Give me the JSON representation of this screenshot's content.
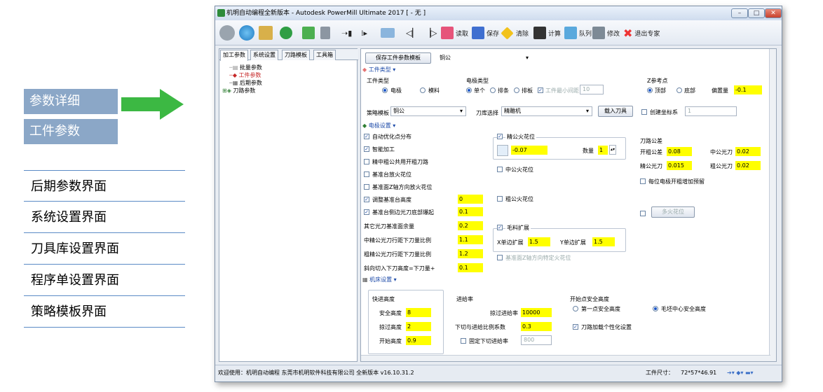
{
  "annotations": {
    "tags": [
      "参数详细",
      "工件参数"
    ],
    "list": [
      "后期参数界面",
      "系统设置界面",
      "刀具库设置界面",
      "程序单设置界面",
      "策略模板界面"
    ]
  },
  "window": {
    "title": "机明自动编程全新版本 - Autodesk PowerMill Ultimate 2017  [ - 无 ]",
    "controls": [
      "minimize",
      "maximize",
      "close"
    ]
  },
  "toolbar": {
    "icons": [
      "gear-icon",
      "globe-icon",
      "clipboard-icon",
      "plus-circle-icon",
      "grid-icon",
      "wrench-icon",
      "step-in-icon",
      "step-icon",
      "folder-icon",
      "first-icon",
      "last-icon"
    ],
    "labeled": [
      {
        "icon": "read-icon",
        "label": "读取"
      },
      {
        "icon": "save-icon",
        "label": "保存"
      },
      {
        "icon": "clear-icon",
        "label": "清除"
      },
      {
        "icon": "calc-icon",
        "label": "计算"
      },
      {
        "icon": "queue-icon",
        "label": "队列"
      },
      {
        "icon": "modify-icon",
        "label": "修改"
      },
      {
        "icon": "exit-icon",
        "label": "退出专家"
      }
    ]
  },
  "left_panel": {
    "tabs": [
      "加工参数",
      "系统设置",
      "刀路模板",
      "工具箱"
    ],
    "tree": [
      "批量参数",
      "工件参数",
      "后期参数",
      "刀路参数"
    ]
  },
  "right_panel": {
    "save_template_button": "保存工件参数模板",
    "template_value": "铜公",
    "workpiece_section": "工件类型",
    "workpiece_type_label": "工件类型",
    "workpiece_type_options": [
      "电极",
      "模料"
    ],
    "electrode_type_label": "电极类型",
    "electrode_type_options": [
      "单个",
      "排条",
      "排板"
    ],
    "min_spacing_label": "工件最小间距",
    "min_spacing_value": "10",
    "z_ref_label": "Z参考点",
    "z_ref_options": [
      "顶部",
      "底部"
    ],
    "offset_label": "偏置量",
    "offset_value": "-0.1",
    "strategy_template_label": "策略模板",
    "strategy_template_value": "铜公",
    "tool_library_label": "刀库选择",
    "tool_library_value": "精雕机",
    "load_tool_button": "载入刀具",
    "create_coord_label": "创建坐标系",
    "create_coord_value": "1",
    "electrode_section": "电极设置",
    "options": [
      {
        "label": "自动优化点分布",
        "checked": true
      },
      {
        "label": "智能加工",
        "checked": true
      },
      {
        "label": "精中粗公共用开粗刀路",
        "checked": false
      },
      {
        "label": "基准台放火花位",
        "checked": false
      },
      {
        "label": "基准面Z轴方向放火花位",
        "checked": false
      },
      {
        "label": "调整基准台高度",
        "checked": true,
        "value": "0"
      },
      {
        "label": "基准台侧边光刀底部爆起",
        "checked": true,
        "value": "0.1"
      }
    ],
    "plain_rows": [
      {
        "label": "其它光刀基准面余量",
        "value": "0.2"
      },
      {
        "label": "中精公光刀行距下刀量比例",
        "value": "1.1"
      },
      {
        "label": "粗精公光刀行距下刀量比例",
        "value": "1.2"
      },
      {
        "label": "斜向切入下刀高度=下刀量+",
        "value": "0.1"
      }
    ],
    "fine_spark_label": "精公火花位",
    "fine_spark_value": "-0.07",
    "quantity_label": "数量",
    "quantity_value": "1",
    "mid_spark_label": "中公火花位",
    "rough_spark_label": "粗公火花位",
    "blank_expand_label": "毛料扩展",
    "x_expand_label": "X单边扩展",
    "x_expand_value": "1.5",
    "y_expand_label": "Y单边扩展",
    "y_expand_value": "1.5",
    "datum_z_spark_label": "基准面Z轴方向特定火花位",
    "tool_tolerance_label": "刀路公差",
    "rough_tol_label": "开粗公差",
    "rough_tol_value": "0.08",
    "mid_finish_label": "中公光刀",
    "mid_finish_value": "0.02",
    "fine_finish_label": "精公光刀",
    "fine_finish_value": "0.015",
    "rough_finish_label": "粗公光刀",
    "rough_finish_value": "0.02",
    "reset_electrode_label": "每位电极开粗增加预留",
    "multi_spark_button": "多火花位",
    "machine_section": "机床设置",
    "rapid_height_label": "快进高度",
    "safe_height_label": "安全高度",
    "safe_height_value": "8",
    "skim_height_label": "掠过高度",
    "skim_height_value": "2",
    "start_height_label": "开始高度",
    "start_height_value": "0.9",
    "feed_label": "进给率",
    "skim_feed_label": "掠过进给率",
    "skim_feed_value": "10000",
    "plunge_ratio_label": "下切与进给比例系数",
    "plunge_ratio_value": "0.3",
    "fixed_plunge_label": "固定下切进给率",
    "fixed_plunge_value": "800",
    "start_safe_label": "开始点安全高度",
    "start_safe_options": [
      "第一点安全高度",
      "毛坯中心安全高度"
    ],
    "tool_personal_label": "刀路加载个性化设置"
  },
  "status": {
    "left": "欢迎使用：机明自动编程 东莞市机明软件科技有限公司 全新版本 v16.10.31.2",
    "size_label": "工件尺寸：",
    "size_value": "72*57*46.91"
  }
}
